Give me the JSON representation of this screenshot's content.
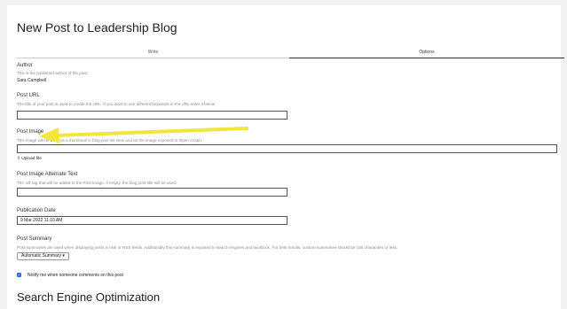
{
  "page": {
    "title": "New Post to Leadership Blog",
    "tabs": [
      {
        "label": "Write"
      },
      {
        "label": "Options"
      }
    ]
  },
  "author": {
    "label": "Author",
    "help": "This is the published author of the post.",
    "value": "Sara Campbell"
  },
  "post_url": {
    "label": "Post URL",
    "help": "The title of your post is used to create the URL. If you want to use different keywords in the URL enter it below.",
    "value": ""
  },
  "post_image": {
    "label": "Post Image",
    "help": "This image will be used as a thumbnail in blog post list view and as the image exposed to Open Graph.",
    "value": "",
    "upload_label": "Upload file",
    "annotation_color": "#f2e63a"
  },
  "alt_text": {
    "label": "Post Image Alternate Text",
    "help": "The 'alt' tag that will be added to the Post Image. If empty, the blog post title will be used.",
    "value": ""
  },
  "publication_date": {
    "label": "Publication Date",
    "value": "9 Mar 2022 11:10 AM"
  },
  "post_summary": {
    "label": "Post Summary",
    "help": "Post summaries are used when displaying posts in lists or RSS feeds. Additionally this summary is exposed to search engines and facebook. For best results, custom summaries should be 155 characters or less.",
    "select_value": "Automatic Summary",
    "chevron": "▾"
  },
  "notify": {
    "label": "Notify me when someone comments on this post",
    "checked": true,
    "checkmark": "✓"
  },
  "seo": {
    "title": "Search Engine Optimization"
  },
  "colors": {
    "checkbox": "#2a6dd6",
    "arrow": "#f2e63a"
  }
}
